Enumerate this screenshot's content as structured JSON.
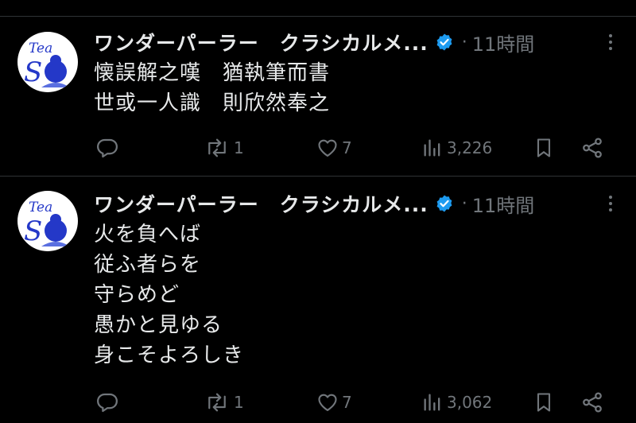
{
  "colors": {
    "background": "#000000",
    "text_primary": "#e7e9ea",
    "text_secondary": "#71767b",
    "verified": "#1d9bf0",
    "divider": "#2f3336",
    "avatar_blue": "#2438c8"
  },
  "posts": [
    {
      "author": "ワンダーパーラー　クラシカルメ...",
      "verified_icon": "verified-badge-icon",
      "dot": "·",
      "time": "11時間",
      "lines": [
        "懐誤解之嘆　猶執筆而書",
        "世或一人識　則欣然奉之"
      ],
      "replies": "",
      "reposts": "1",
      "likes": "7",
      "views": "3,226"
    },
    {
      "author": "ワンダーパーラー　クラシカルメ...",
      "verified_icon": "verified-badge-icon",
      "dot": "·",
      "time": "11時間",
      "lines": [
        "火を負へば",
        "従ふ者らを",
        "守らめど",
        "愚かと見ゆる",
        "身こそよろしき"
      ],
      "replies": "",
      "reposts": "1",
      "likes": "7",
      "views": "3,062"
    }
  ]
}
